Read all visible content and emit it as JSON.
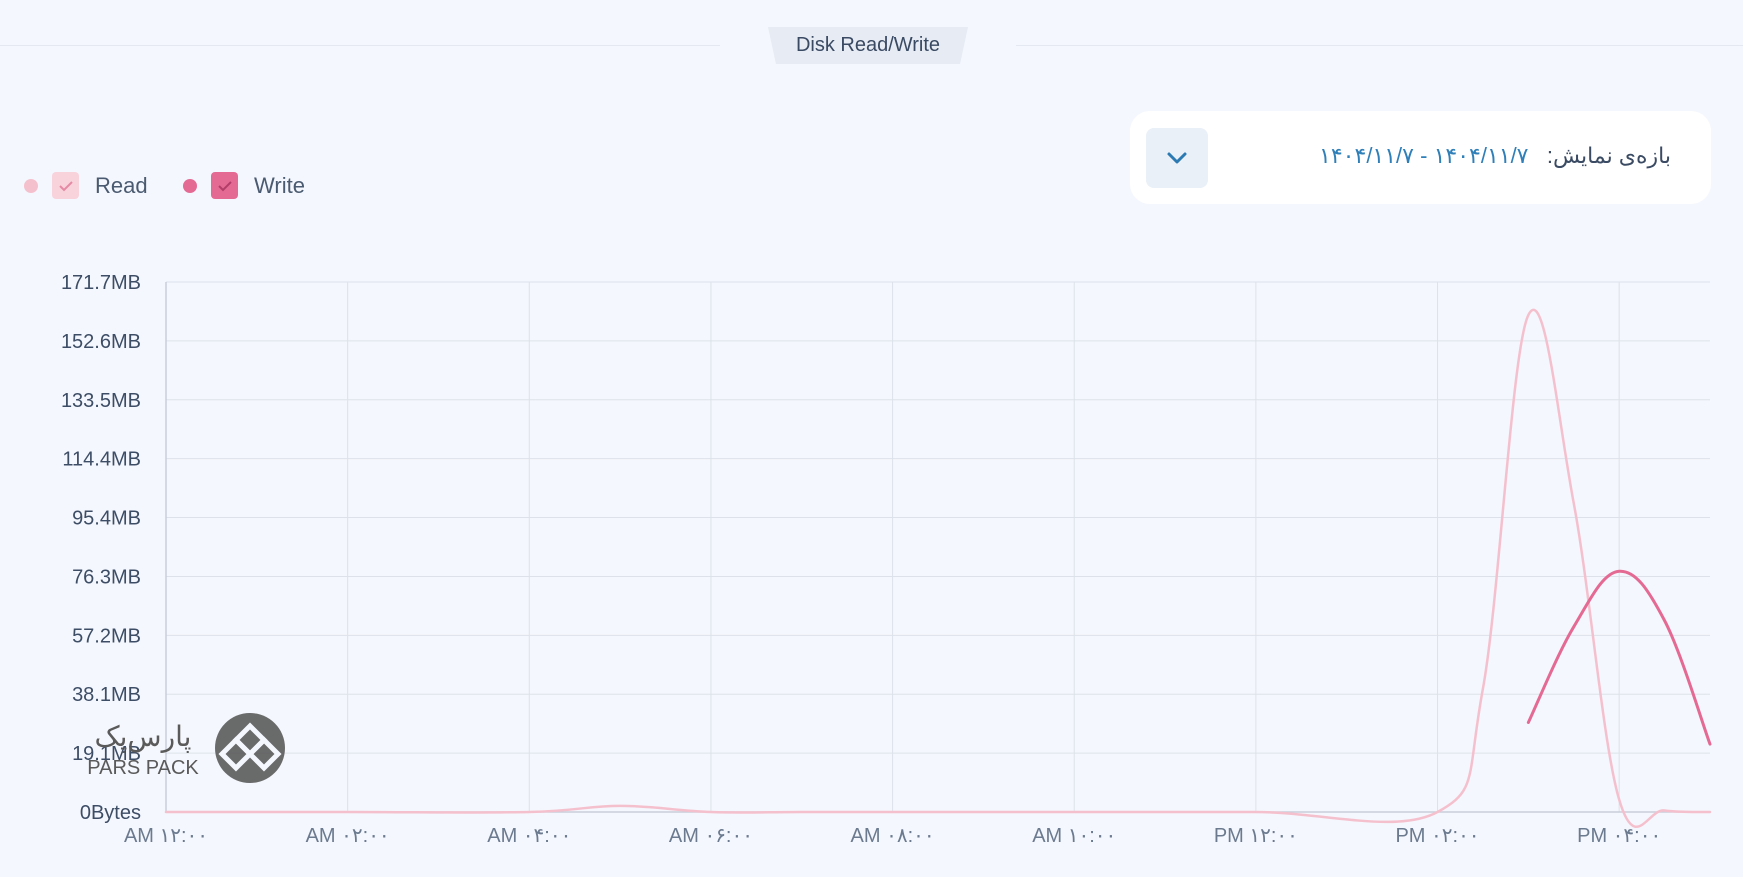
{
  "chart_data": {
    "type": "line",
    "title": "Disk Read/Write",
    "x_categories": [
      "AM ۱۲:۰۰",
      "AM ۰۲:۰۰",
      "AM ۰۴:۰۰",
      "AM ۰۶:۰۰",
      "AM ۰۸:۰۰",
      "AM ۱۰:۰۰",
      "PM ۱۲:۰۰",
      "PM ۰۲:۰۰",
      "PM ۰۴:۰۰"
    ],
    "y_ticks": [
      "0Bytes",
      "19.1MB",
      "38.1MB",
      "57.2MB",
      "76.3MB",
      "95.4MB",
      "114.4MB",
      "133.5MB",
      "152.6MB",
      "171.7MB"
    ],
    "ylim": [
      0,
      171.7
    ],
    "y_unit": "MB",
    "grid": true,
    "legend_position": "top-left",
    "series": [
      {
        "name": "Read",
        "color": "#f5c0cd",
        "points": [
          [
            0,
            0
          ],
          [
            2,
            0
          ],
          [
            4,
            0
          ],
          [
            5,
            2
          ],
          [
            6,
            0
          ],
          [
            7,
            0
          ],
          [
            8,
            0
          ],
          [
            10,
            0
          ],
          [
            12,
            0
          ],
          [
            14,
            0
          ],
          [
            14.5,
            40
          ],
          [
            15,
            161
          ],
          [
            15.5,
            100
          ],
          [
            16,
            4
          ],
          [
            16.5,
            0.5
          ],
          [
            17,
            0
          ]
        ]
      },
      {
        "name": "Write",
        "color": "#e46a94",
        "points": [
          [
            15,
            29
          ],
          [
            15.5,
            60
          ],
          [
            16,
            78
          ],
          [
            16.5,
            62
          ],
          [
            17,
            22
          ]
        ]
      }
    ]
  },
  "range_selector": {
    "label": "بازه‌ی نمایش:",
    "value": "۱۴۰۴/۱۱/۷ - ۱۴۰۴/۱۱/۷",
    "icon": "chevron-down-icon"
  },
  "legend": {
    "read_label": "Read",
    "write_label": "Write",
    "read_color": "#f5c0cd",
    "write_color": "#e46a94"
  },
  "watermark": {
    "brand_fa": "پارس‌پک",
    "brand_en": "PARS PACK"
  }
}
